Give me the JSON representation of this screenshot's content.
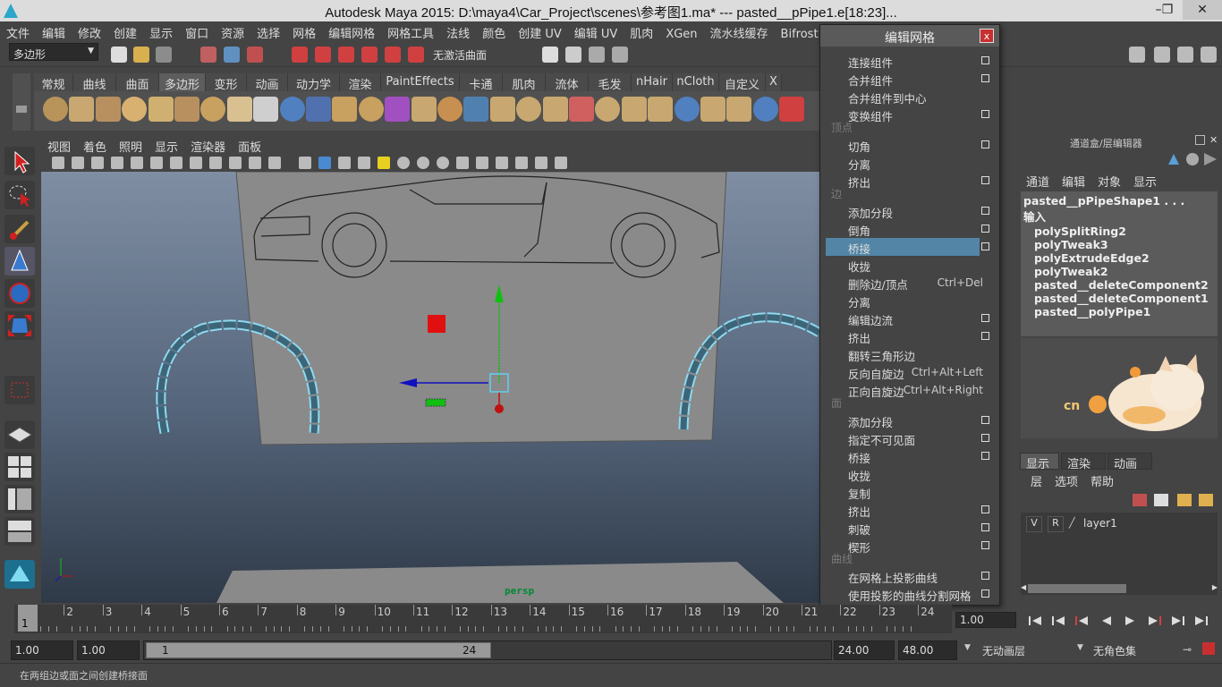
{
  "window": {
    "title": "Autodesk Maya 2015: D:\\maya4\\Car_Project\\scenes\\参考图1.ma*   ---   pasted__pPipe1.e[18:23]...",
    "minimize": "–",
    "maximize": "❐",
    "close": "✕"
  },
  "menubar": [
    "文件",
    "编辑",
    "修改",
    "创建",
    "显示",
    "窗口",
    "资源",
    "选择",
    "网格",
    "编辑网格",
    "网格工具",
    "法线",
    "颜色",
    "创建 UV",
    "编辑 UV",
    "肌肉",
    "XGen",
    "流水线缓存",
    "Bifrost",
    "帮助"
  ],
  "statusline": {
    "mode_dropdown": "多边形",
    "live_field": "无激活曲面"
  },
  "shelf": {
    "tabs": [
      "常规",
      "曲线",
      "曲面",
      "多边形",
      "变形",
      "动画",
      "动力学",
      "渲染",
      "PaintEffects",
      "卡通",
      "肌肉",
      "流体",
      "毛发",
      "nHair",
      "nCloth",
      "自定义",
      "X"
    ],
    "active_tab": "多边形"
  },
  "panel": {
    "menu": [
      "视图",
      "着色",
      "照明",
      "显示",
      "渲染器",
      "面板"
    ],
    "camera_label": "persp"
  },
  "popup": {
    "title": "编辑网格",
    "close": "x",
    "sections": {
      "vertex": "顶点",
      "edge": "边",
      "face": "面",
      "curve": "曲线"
    },
    "items_top": [
      {
        "label": "连接组件",
        "box": true
      },
      {
        "label": "合并组件",
        "box": true
      },
      {
        "label": "合并组件到中心",
        "box": false
      },
      {
        "label": "变换组件",
        "box": true
      }
    ],
    "items_vertex": [
      {
        "label": "切角",
        "box": true
      },
      {
        "label": "分离",
        "box": false
      },
      {
        "label": "挤出",
        "box": true
      }
    ],
    "items_edge": [
      {
        "label": "添加分段",
        "box": true,
        "shortcut": ""
      },
      {
        "label": "倒角",
        "box": true,
        "shortcut": ""
      },
      {
        "label": "桥接",
        "box": true,
        "shortcut": "",
        "highlight": true
      },
      {
        "label": "收拢",
        "box": false,
        "shortcut": ""
      },
      {
        "label": "删除边/顶点",
        "box": false,
        "shortcut": "Ctrl+Del"
      },
      {
        "label": "分离",
        "box": false,
        "shortcut": ""
      },
      {
        "label": "编辑边流",
        "box": true,
        "shortcut": ""
      },
      {
        "label": "挤出",
        "box": true,
        "shortcut": ""
      },
      {
        "label": "翻转三角形边",
        "box": false,
        "shortcut": ""
      },
      {
        "label": "反向自旋边",
        "box": false,
        "shortcut": "Ctrl+Alt+Left"
      },
      {
        "label": "正向自旋边",
        "box": false,
        "shortcut": "Ctrl+Alt+Right"
      }
    ],
    "items_face": [
      {
        "label": "添加分段",
        "box": true
      },
      {
        "label": "指定不可见面",
        "box": true
      },
      {
        "label": "桥接",
        "box": true
      },
      {
        "label": "收拢",
        "box": false
      },
      {
        "label": "复制",
        "box": false
      },
      {
        "label": "挤出",
        "box": true
      },
      {
        "label": "刺破",
        "box": true
      },
      {
        "label": "楔形",
        "box": true
      }
    ],
    "items_curve": [
      {
        "label": "在网格上投影曲线",
        "box": true
      },
      {
        "label": "使用投影的曲线分割网格",
        "box": true
      }
    ]
  },
  "channelbox": {
    "header": "通道盒/层编辑器",
    "tabs": [
      "通道",
      "编辑",
      "对象",
      "显示"
    ],
    "object": "pasted__pPipeShape1 . . .",
    "inputs_label": "输入",
    "inputs": [
      "polySplitRing2",
      "polyTweak3",
      "polyExtrudeEdge2",
      "polyTweak2",
      "pasted__deleteComponent2",
      "pasted__deleteComponent1",
      "pasted__polyPipe1"
    ]
  },
  "layers": {
    "tabs": [
      "显示",
      "渲染",
      "动画"
    ],
    "active_tab": "显示",
    "menu": [
      "层",
      "选项",
      "帮助"
    ],
    "row": {
      "v": "V",
      "r": "R",
      "name": "layer1"
    }
  },
  "timeline": {
    "ticks": [
      "1",
      "2",
      "3",
      "4",
      "5",
      "6",
      "7",
      "8",
      "9",
      "10",
      "11",
      "12",
      "13",
      "14",
      "15",
      "16",
      "17",
      "18",
      "19",
      "20",
      "21",
      "22",
      "23",
      "24"
    ],
    "current_frame": "1",
    "frame_field": "1.00"
  },
  "range": {
    "start": "1.00",
    "anim_start": "1.00",
    "slider_start": "1",
    "slider_end": "24",
    "anim_end": "24.00",
    "end": "48.00",
    "anim_layer": "无动画层",
    "char_set": "无角色集"
  },
  "helpline": "在两组边或面之间创建桥接面",
  "colors": {
    "highlight": "#5285a6",
    "close_red": "#c83030",
    "manip_x": "#1010c0",
    "manip_y": "#10c010",
    "manip_z": "#c01010"
  }
}
